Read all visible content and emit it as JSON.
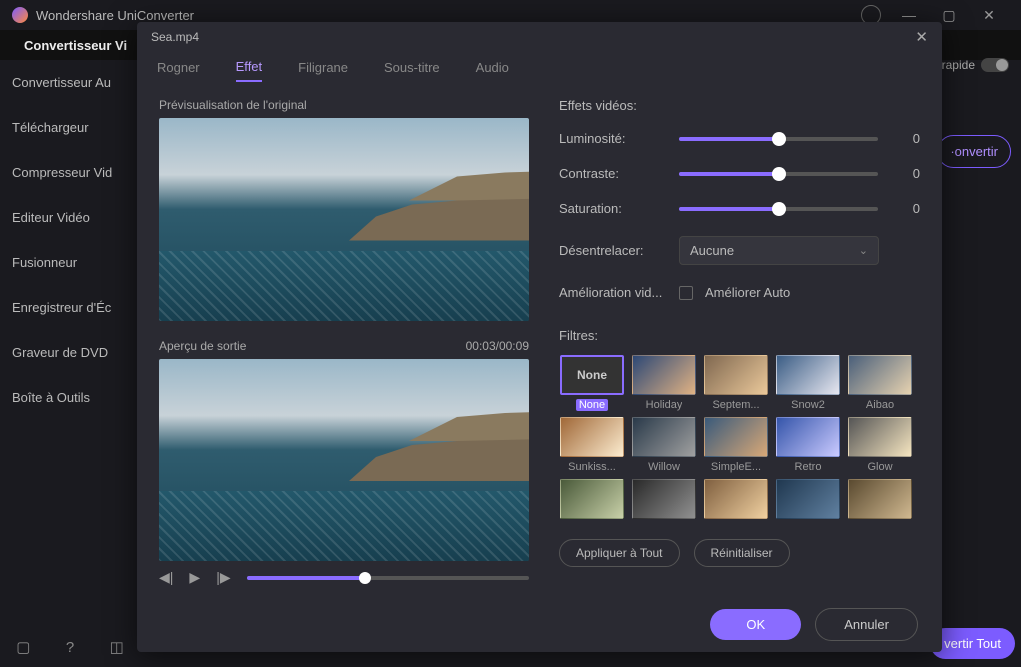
{
  "app": {
    "title": "Wondershare UniConverter"
  },
  "window": {
    "minimize": "—",
    "maximize": "▢",
    "close": "✕"
  },
  "maintab": {
    "label": "Convertisseur Vi"
  },
  "rapide": {
    "label": "rapide"
  },
  "sidebar": {
    "items": [
      {
        "label": "Convertisseur Au"
      },
      {
        "label": "Téléchargeur"
      },
      {
        "label": "Compresseur Vid"
      },
      {
        "label": "Editeur Vidéo"
      },
      {
        "label": "Fusionneur"
      },
      {
        "label": "Enregistreur d'Éc"
      },
      {
        "label": "Graveur de DVD"
      },
      {
        "label": "Boîte à Outils"
      }
    ]
  },
  "convert_btn": "·onvertir",
  "convert_all": "vertir Tout",
  "modal": {
    "filename": "Sea.mp4",
    "tabs": {
      "rogner": "Rogner",
      "effet": "Effet",
      "filigrane": "Filigrane",
      "soustitre": "Sous-titre",
      "audio": "Audio"
    },
    "preview_original": "Prévisualisation de l'original",
    "preview_output": "Aperçu de sortie",
    "timecode": "00:03/00:09",
    "effects": {
      "heading": "Effets vidéos:",
      "brightness": {
        "label": "Luminosité:",
        "value": "0"
      },
      "contrast": {
        "label": "Contraste:",
        "value": "0"
      },
      "saturation": {
        "label": "Saturation:",
        "value": "0"
      },
      "deinterlace": {
        "label": "Désentrelacer:",
        "value": "Aucune"
      },
      "enhance": {
        "label": "Amélioration vid...",
        "checkbox_label": "Améliorer Auto"
      },
      "filters_label": "Filtres:",
      "filters": [
        {
          "name": "None",
          "selected": true
        },
        {
          "name": "Holiday"
        },
        {
          "name": "Septem..."
        },
        {
          "name": "Snow2"
        },
        {
          "name": "Aibao"
        },
        {
          "name": "Sunkiss..."
        },
        {
          "name": "Willow"
        },
        {
          "name": "SimpleE..."
        },
        {
          "name": "Retro"
        },
        {
          "name": "Glow"
        },
        {
          "name": ""
        },
        {
          "name": ""
        },
        {
          "name": ""
        },
        {
          "name": ""
        },
        {
          "name": ""
        }
      ],
      "apply_all": "Appliquer à Tout",
      "reset": "Réinitialiser"
    },
    "footer": {
      "ok": "OK",
      "cancel": "Annuler"
    }
  }
}
